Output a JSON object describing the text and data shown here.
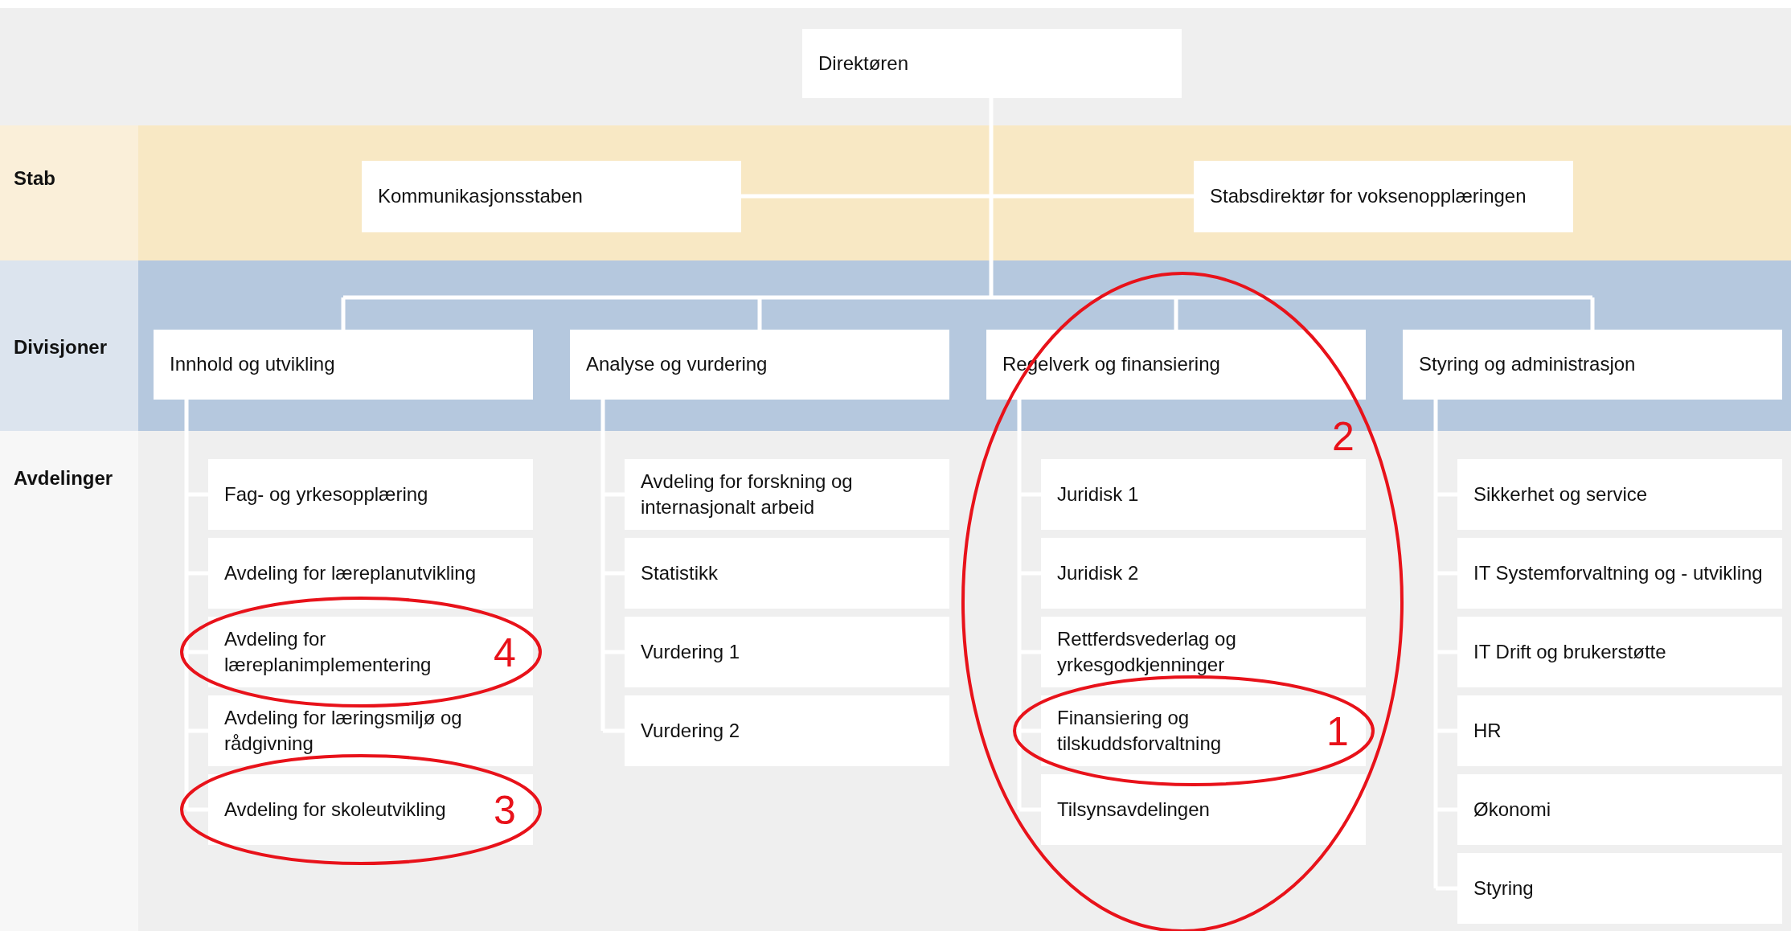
{
  "director": {
    "title": "Direktøren"
  },
  "row_labels": {
    "staff": "Stab",
    "divisions": "Divisjoner",
    "departments": "Avdelinger"
  },
  "staff": [
    {
      "name": "Kommunikasjonsstaben"
    },
    {
      "name": "Stabsdirektør for voksenopplæringen"
    }
  ],
  "divisions": [
    {
      "name": "Innhold og utvikling",
      "departments": [
        {
          "name": "Fag- og yrkesopplæring"
        },
        {
          "name": "Avdeling for læreplanutvikling"
        },
        {
          "name": "Avdeling for læreplanimplementering",
          "annotation": "4"
        },
        {
          "name": "Avdeling for læringsmiljø og rådgivning"
        },
        {
          "name": "Avdeling for skoleutvikling",
          "annotation": "3"
        }
      ]
    },
    {
      "name": "Analyse og vurdering",
      "departments": [
        {
          "name": "Avdeling for forskning og internasjonalt arbeid"
        },
        {
          "name": "Statistikk"
        },
        {
          "name": "Vurdering 1"
        },
        {
          "name": "Vurdering 2"
        }
      ]
    },
    {
      "name": "Regelverk og finansiering",
      "annotation": "2",
      "departments": [
        {
          "name": "Juridisk 1"
        },
        {
          "name": "Juridisk 2"
        },
        {
          "name": "Rettferdsvederlag og yrkesgodkjenninger"
        },
        {
          "name": "Finansiering og tilskuddsforvaltning",
          "annotation": "1"
        },
        {
          "name": "Tilsynsavdelingen"
        }
      ]
    },
    {
      "name": "Styring og administrasjon",
      "departments": [
        {
          "name": "Sikkerhet og service"
        },
        {
          "name": "IT Systemforvaltning og - utvikling"
        },
        {
          "name": "IT Drift og brukerstøtte"
        },
        {
          "name": "HR"
        },
        {
          "name": "Økonomi"
        },
        {
          "name": "Styring"
        }
      ]
    }
  ]
}
